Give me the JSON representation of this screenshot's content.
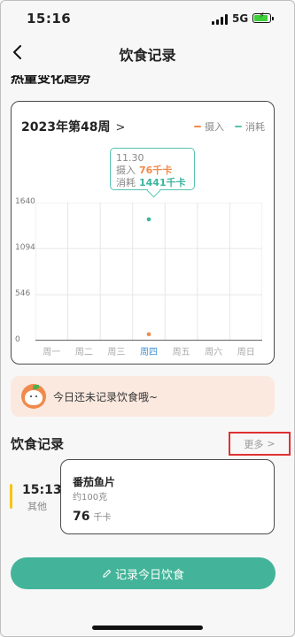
{
  "status": {
    "time": "15:16",
    "network": "5G"
  },
  "nav": {
    "title": "饮食记录"
  },
  "trend_title": "热量变化趋势",
  "chart_card": {
    "week_label": "2023年第48周",
    "legend": [
      {
        "label": "摄入",
        "color": "#f08a4b"
      },
      {
        "label": "消耗",
        "color": "#55c4b0"
      }
    ],
    "tooltip": {
      "date": "11.30",
      "intake_label": "摄入",
      "intake_value": "76千卡",
      "burn_label": "消耗",
      "burn_value": "1441千卡"
    }
  },
  "chart_data": {
    "type": "scatter",
    "categories": [
      "周一",
      "周二",
      "周三",
      "周四",
      "周五",
      "周六",
      "周日"
    ],
    "active_category": "周四",
    "y_ticks": [
      "0",
      "546",
      "1094",
      "1640"
    ],
    "ylim": [
      0,
      1640
    ],
    "grid": true,
    "series": [
      {
        "name": "摄入",
        "color": "#f08a4b",
        "values": [
          null,
          null,
          null,
          76,
          null,
          null,
          null
        ]
      },
      {
        "name": "消耗",
        "color": "#3bb59f",
        "values": [
          null,
          null,
          null,
          1441,
          null,
          null,
          null
        ]
      }
    ]
  },
  "notice": {
    "text": "今日还未记录饮食哦~"
  },
  "records": {
    "title": "饮食记录",
    "more_label": "更多",
    "items": [
      {
        "time": "15:13",
        "type": "其他",
        "name": "番茄鱼片",
        "qty": "约100克",
        "kcal": "76",
        "unit": "千卡"
      }
    ]
  },
  "primary_button": {
    "label": "记录今日饮食"
  }
}
